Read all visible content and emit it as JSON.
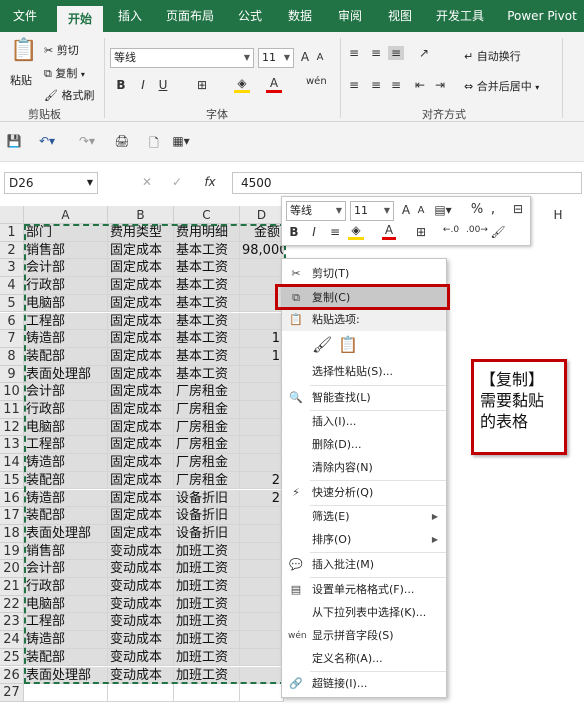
{
  "tabs": [
    "文件",
    "开始",
    "插入",
    "页面布局",
    "公式",
    "数据",
    "审阅",
    "视图",
    "开发工具",
    "Power Pivot"
  ],
  "active_tab": "开始",
  "clipboard": {
    "paste": "粘贴",
    "cut": "剪切",
    "copy": "复制",
    "format_painter": "格式刷",
    "group_label": "剪贴板"
  },
  "font": {
    "name": "等线",
    "size": "11",
    "group_label": "字体",
    "bold": "B",
    "italic": "I",
    "underline": "U"
  },
  "alignment": {
    "wrap_text": "自动换行",
    "merge_center": "合并后居中",
    "group_label": "对齐方式"
  },
  "formula_bar": {
    "name_box": "D26",
    "value": "4500",
    "fx": "fx"
  },
  "columns": [
    "A",
    "B",
    "C",
    "D",
    "H"
  ],
  "rows": [
    [
      "1",
      "部门",
      "费用类型",
      "费用明细",
      "金额"
    ],
    [
      "2",
      "销售部",
      "固定成本",
      "基本工资",
      "98,000"
    ],
    [
      "3",
      "会计部",
      "固定成本",
      "基本工资",
      ""
    ],
    [
      "4",
      "行政部",
      "固定成本",
      "基本工资",
      ""
    ],
    [
      "5",
      "电脑部",
      "固定成本",
      "基本工资",
      ""
    ],
    [
      "6",
      "工程部",
      "固定成本",
      "基本工资",
      ""
    ],
    [
      "7",
      "铸造部",
      "固定成本",
      "基本工资",
      "1"
    ],
    [
      "8",
      "装配部",
      "固定成本",
      "基本工资",
      "1"
    ],
    [
      "9",
      "表面处理部",
      "固定成本",
      "基本工资",
      ""
    ],
    [
      "10",
      "会计部",
      "固定成本",
      "厂房租金",
      ""
    ],
    [
      "11",
      "行政部",
      "固定成本",
      "厂房租金",
      ""
    ],
    [
      "12",
      "电脑部",
      "固定成本",
      "厂房租金",
      ""
    ],
    [
      "13",
      "工程部",
      "固定成本",
      "厂房租金",
      ""
    ],
    [
      "14",
      "铸造部",
      "固定成本",
      "厂房租金",
      ""
    ],
    [
      "15",
      "装配部",
      "固定成本",
      "厂房租金",
      "2"
    ],
    [
      "16",
      "铸造部",
      "固定成本",
      "设备折旧",
      "2"
    ],
    [
      "17",
      "装配部",
      "固定成本",
      "设备折旧",
      ""
    ],
    [
      "18",
      "表面处理部",
      "固定成本",
      "设备折旧",
      ""
    ],
    [
      "19",
      "销售部",
      "变动成本",
      "加班工资",
      ""
    ],
    [
      "20",
      "会计部",
      "变动成本",
      "加班工资",
      ""
    ],
    [
      "21",
      "行政部",
      "变动成本",
      "加班工资",
      ""
    ],
    [
      "22",
      "电脑部",
      "变动成本",
      "加班工资",
      ""
    ],
    [
      "23",
      "工程部",
      "变动成本",
      "加班工资",
      ""
    ],
    [
      "24",
      "铸造部",
      "变动成本",
      "加班工资",
      ""
    ],
    [
      "25",
      "装配部",
      "变动成本",
      "加班工资",
      ""
    ],
    [
      "26",
      "表面处理部",
      "变动成本",
      "加班工资",
      ""
    ],
    [
      "27",
      "",
      "",
      "",
      ""
    ]
  ],
  "mini_toolbar": {
    "font": "等线",
    "size": "11",
    "percent": "%",
    "comma": ","
  },
  "context_menu": {
    "cut": "剪切(T)",
    "copy": "复制(C)",
    "paste_options": "粘贴选项:",
    "paste_special": "选择性粘贴(S)...",
    "smart_lookup": "智能查找(L)",
    "insert": "插入(I)...",
    "delete": "删除(D)...",
    "clear": "清除内容(N)",
    "quick_analysis": "快速分析(Q)",
    "filter": "筛选(E)",
    "sort": "排序(O)",
    "insert_comment": "插入批注(M)",
    "format_cells": "设置单元格格式(F)...",
    "pick_list": "从下拉列表中选择(K)...",
    "phonetic": "显示拼音字段(S)",
    "define_name": "定义名称(A)...",
    "hyperlink": "超链接(I)..."
  },
  "annotation": "【复制】需要黏贴的表格",
  "colors": {
    "excel_green": "#217346",
    "highlight_red": "#c00000"
  }
}
